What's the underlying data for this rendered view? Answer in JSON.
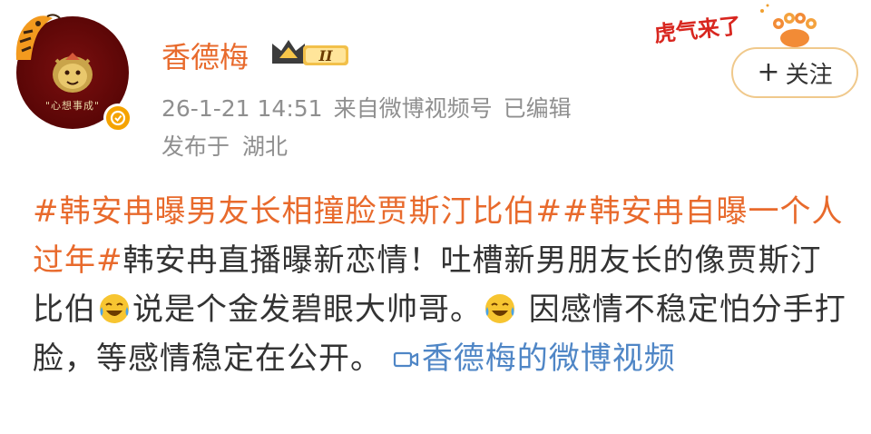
{
  "user": {
    "name": "香德梅",
    "vip_level": "II",
    "avatar_text": "\"心想事成\""
  },
  "meta": {
    "timestamp": "26-1-21 14:51",
    "source_prefix": "来自",
    "source": "微博视频号",
    "edited": "已编辑",
    "location_label": "发布于",
    "location": "湖北"
  },
  "sticker": {
    "text": "虎气来了"
  },
  "follow_button": {
    "plus": "+",
    "label": "关注"
  },
  "post": {
    "hashtag_1": "#韩安冉曝男友长相撞脸贾斯汀比伯#",
    "hashtag_2": "#韩安冉自曝一个人过年#",
    "text_1": "韩安冉直播曝新恋情！吐槽新男朋友长的像贾斯汀比伯",
    "emoji_1": "laugh-cry-emoji",
    "text_2": "说是个金发碧眼大帅哥。",
    "emoji_2": "laugh-cry-emoji",
    "text_3": " 因感情不稳定怕分手打脸，等感情稳定在公开。 ",
    "video_link": "香德梅的微博视频"
  },
  "colors": {
    "username": "#e86a2c",
    "hashtag": "#e86a2c",
    "link": "#4f86c6",
    "meta": "#8f8f8f",
    "follow_border": "#f0c98c"
  }
}
